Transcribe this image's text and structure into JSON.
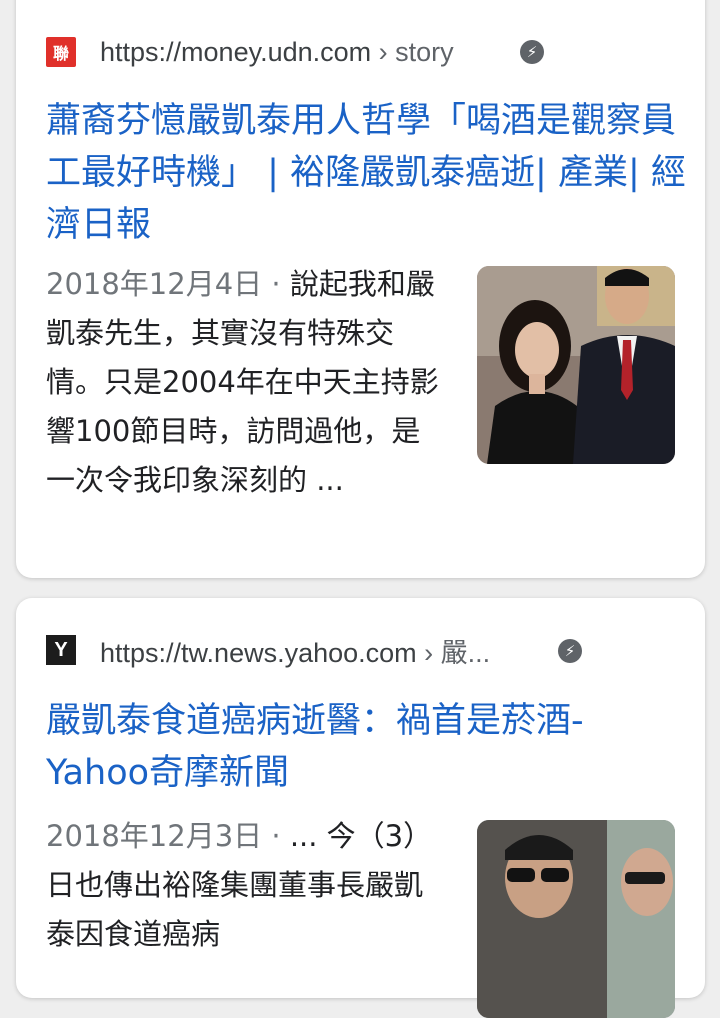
{
  "results": [
    {
      "site_url": "https://money.udn.com",
      "site_path": " › story",
      "favicon_icon": "udn-logo-icon",
      "title": "蕭裔芬憶嚴凱泰用人哲學「喝酒是觀察員工最好時機」 | 裕隆嚴凱泰癌逝| 產業| 經濟日報",
      "date": "2018年12月4日",
      "separator": " · ",
      "snippet": "說起我和嚴凱泰先生，其實沒有特殊交情。只是2004年在中天主持影響100節目時，訪問過他，是一次令我印象深刻的 ...",
      "thumbnail": "photo of woman and man in suit"
    },
    {
      "site_url": "https://tw.news.yahoo.com",
      "site_path": " › 嚴...",
      "favicon_icon": "yahoo-logo-icon",
      "title": "嚴凱泰食道癌病逝醫：禍首是菸酒- Yahoo奇摩新聞",
      "date": "2018年12月3日",
      "separator": " · ",
      "snippet": "... 今（3）日也傳出裕隆集團董事長嚴凱泰因食道癌病",
      "thumbnail": "photo of men wearing sunglasses"
    }
  ],
  "colors": {
    "title_link": "#1a62c6",
    "favicon_udn": "#e0302a",
    "favicon_yahoo": "#1c1c1c"
  }
}
